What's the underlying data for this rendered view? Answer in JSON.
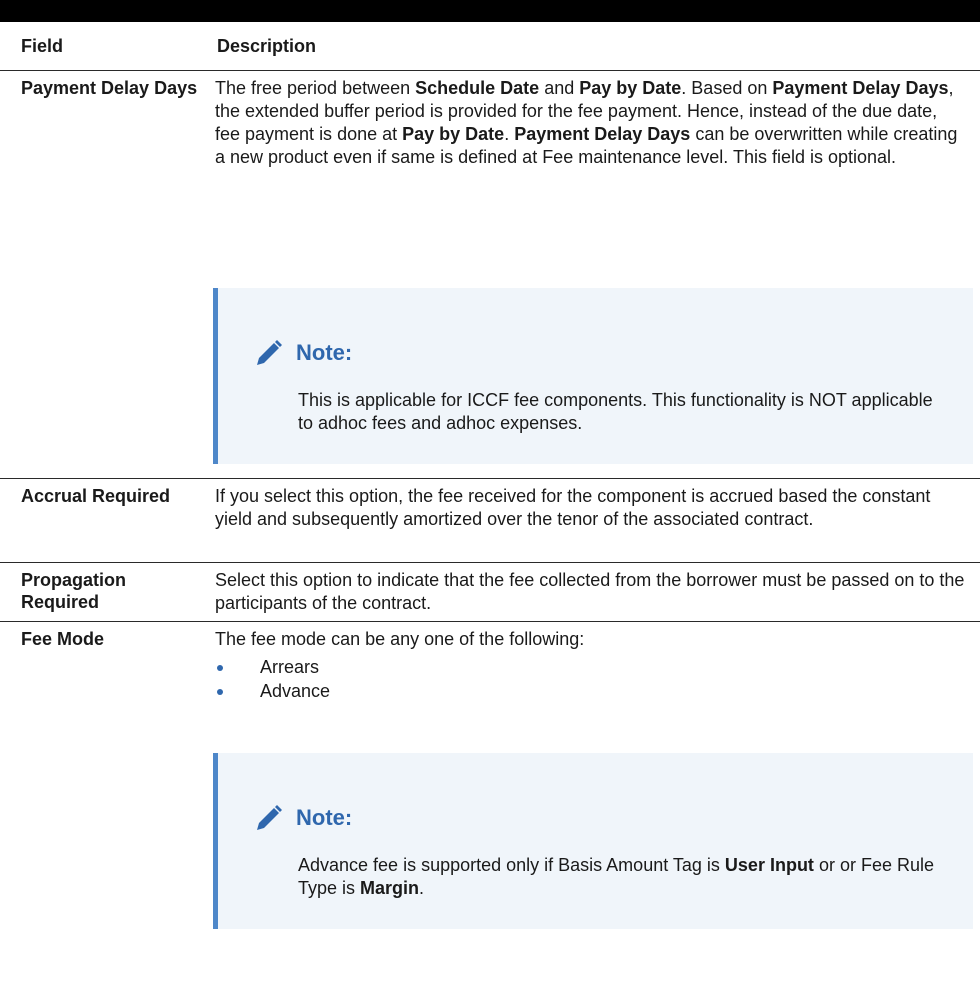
{
  "table": {
    "headers": {
      "field": "Field",
      "description": "Description"
    },
    "rows": [
      {
        "field": "Payment Delay Days",
        "description": [
          {
            "t": "The free period between "
          },
          {
            "t": "Schedule Date",
            "b": true
          },
          {
            "t": " and "
          },
          {
            "t": "Pay by Date",
            "b": true
          },
          {
            "t": ". Based on "
          },
          {
            "t": "Payment Delay Days",
            "b": true
          },
          {
            "t": ", the extended buffer period is provided for the fee payment. Hence, instead of the due date, fee payment is done at "
          },
          {
            "t": "Pay by Date",
            "b": true
          },
          {
            "t": ". "
          },
          {
            "t": "Payment Delay Days",
            "b": true
          },
          {
            "t": " can be overwritten while creating a new product even if same is defined at Fee maintenance level. This field is optional."
          }
        ],
        "note": {
          "title": "Note:",
          "body": [
            {
              "t": "This is applicable for ICCF fee components. This functionality is NOT applicable to adhoc fees and adhoc expenses."
            }
          ]
        }
      },
      {
        "field": "Accrual Required",
        "description": [
          {
            "t": "If you select this option, the fee received for the component is accrued based the constant yield and subsequently amortized over the tenor of the associated contract."
          }
        ]
      },
      {
        "field": "Propagation Required",
        "description": [
          {
            "t": "Select this option to indicate that the fee collected from the borrower must be passed on to the participants of the contract."
          }
        ]
      },
      {
        "field": "Fee Mode",
        "description": [
          {
            "t": "The fee mode can be any one of the following:"
          }
        ],
        "bullets": [
          "Arrears",
          "Advance"
        ],
        "note": {
          "title": "Note:",
          "body": [
            {
              "t": "Advance fee is supported only if Basis Amount Tag is "
            },
            {
              "t": "User Input",
              "b": true
            },
            {
              "t": " or or Fee Rule Type is "
            },
            {
              "t": "Margin",
              "b": true
            },
            {
              "t": "."
            }
          ]
        }
      }
    ]
  },
  "colors": {
    "note_bg": "#f0f5fa",
    "note_border": "#4e87c9",
    "note_title": "#2f67ad",
    "bullet": "#2f67ad"
  },
  "icons": {
    "note": "pencil-icon",
    "bullet": "bullet-dot-icon"
  }
}
